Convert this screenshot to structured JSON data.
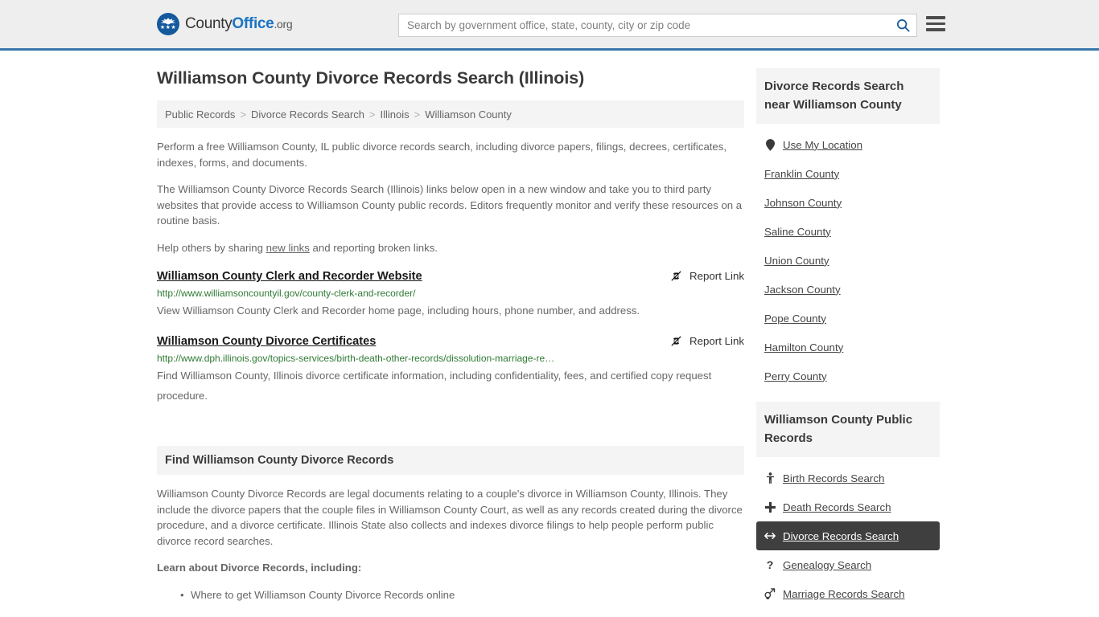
{
  "header": {
    "logo": {
      "text_county": "County",
      "text_office": "Office",
      "text_org": ".org",
      "stars": "★★★"
    },
    "search": {
      "placeholder": "Search by government office, state, county, city or zip code",
      "value": ""
    }
  },
  "main": {
    "title": "Williamson County Divorce Records Search (Illinois)",
    "breadcrumb": [
      "Public Records",
      "Divorce Records Search",
      "Illinois",
      "Williamson County"
    ],
    "breadcrumb_separator": ">",
    "intro_1": "Perform a free Williamson County, IL public divorce records search, including divorce papers, filings, decrees, certificates, indexes, forms, and documents.",
    "intro_2": "The Williamson County Divorce Records Search (Illinois) links below open in a new window and take you to third party websites that provide access to Williamson County public records. Editors frequently monitor and verify these resources on a routine basis.",
    "help_prefix": "Help others by sharing ",
    "help_link": "new links",
    "help_suffix": " and reporting broken links.",
    "report_link_label": "Report Link",
    "results": [
      {
        "title": "Williamson County Clerk and Recorder Website",
        "url": "http://www.williamsoncountyil.gov/county-clerk-and-recorder/",
        "description": "View Williamson County Clerk and Recorder home page, including hours, phone number, and address.",
        "report_label": "Report Link"
      },
      {
        "title": "Williamson County Divorce Certificates",
        "url": "http://www.dph.illinois.gov/topics-services/birth-death-other-records/dissolution-marriage-re…",
        "description": "Find Williamson County, Illinois divorce certificate information, including confidentiality, fees, and certified copy request procedure.",
        "report_label": "Report Link"
      }
    ],
    "section": {
      "heading": "Find Williamson County Divorce Records",
      "body": "Williamson County Divorce Records are legal documents relating to a couple's divorce in Williamson County, Illinois. They include the divorce papers that the couple files in Williamson County Court, as well as any records created during the divorce procedure, and a divorce certificate. Illinois State also collects and indexes divorce filings to help people perform public divorce record searches.",
      "learn_label": "Learn about Divorce Records, including:",
      "bullets": [
        "Where to get Williamson County Divorce Records online"
      ]
    }
  },
  "sidebar": {
    "nearby": {
      "heading": "Divorce Records Search near Williamson County",
      "items": [
        {
          "label": "Use My Location",
          "icon": "map-pin-icon"
        },
        {
          "label": "Franklin County",
          "icon": ""
        },
        {
          "label": "Johnson County",
          "icon": ""
        },
        {
          "label": "Saline County",
          "icon": ""
        },
        {
          "label": "Union County",
          "icon": ""
        },
        {
          "label": "Jackson County",
          "icon": ""
        },
        {
          "label": "Pope County",
          "icon": ""
        },
        {
          "label": "Hamilton County",
          "icon": ""
        },
        {
          "label": "Perry County",
          "icon": ""
        }
      ]
    },
    "public_records": {
      "heading": "Williamson County Public Records",
      "items": [
        {
          "label": "Birth Records Search",
          "icon": "baby-icon",
          "active": false
        },
        {
          "label": "Death Records Search",
          "icon": "cross-icon",
          "active": false
        },
        {
          "label": "Divorce Records Search",
          "icon": "arrows-left-right-icon",
          "active": true
        },
        {
          "label": "Genealogy Search",
          "icon": "question-mark-icon",
          "active": false
        },
        {
          "label": "Marriage Records Search",
          "icon": "mars-venus-icon",
          "active": false
        }
      ]
    }
  },
  "colors": {
    "brand_blue": "#15599c",
    "header_bg": "#eeeeee",
    "header_rule": "#3a77ab",
    "url_green": "#2f7a33",
    "active_bg": "#3f3f3f",
    "panel_bg": "#f4f4f4"
  }
}
